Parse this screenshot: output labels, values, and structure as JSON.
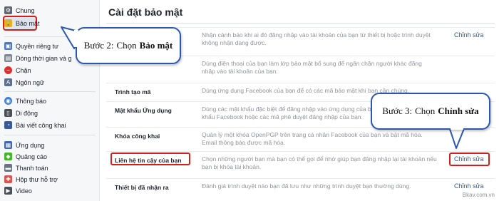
{
  "sidebar": {
    "items": [
      {
        "label": "Chung",
        "icon": "gear-icon"
      },
      {
        "label": "Bảo mật",
        "icon": "lock-icon"
      },
      {
        "label": "Quyền riêng tư",
        "icon": "privacy-icon"
      },
      {
        "label": "Dòng thời gian và g",
        "icon": "timeline-icon"
      },
      {
        "label": "Chặn",
        "icon": "block-icon"
      },
      {
        "label": "Ngôn ngữ",
        "icon": "language-icon"
      },
      {
        "label": "Thông báo",
        "icon": "globe-icon"
      },
      {
        "label": "Di động",
        "icon": "mobile-icon"
      },
      {
        "label": "Bài viết công khai",
        "icon": "rss-icon"
      },
      {
        "label": "Ứng dụng",
        "icon": "apps-icon"
      },
      {
        "label": "Quảng cáo",
        "icon": "ads-icon"
      },
      {
        "label": "Thanh toán",
        "icon": "payment-icon"
      },
      {
        "label": "Hộp thư hỗ trợ",
        "icon": "support-inbox-icon"
      },
      {
        "label": "Video",
        "icon": "video-icon"
      }
    ]
  },
  "main": {
    "title": "Cài đặt bảo mật",
    "edit_label": "Chỉnh sửa",
    "rows": [
      {
        "label": "",
        "desc": "Nhận cảnh báo khi ai đó đăng nhập vào tài khoản của bạn từ thiết bị hoặc trình duyệt không nhận dạng được.",
        "edit": "Chỉnh sửa"
      },
      {
        "label": "",
        "desc": "Dùng điện thoại của bạn làm lớp bảo mật bổ sung để ngăn chặn người khác đăng nhập vào tài khoản của bạn.",
        "edit": ""
      },
      {
        "label": "Trình tạo mã",
        "desc": "Dùng ứng dụng Facebook của bạn để có các mã bảo mật khi bạn cần chúng.",
        "edit": ""
      },
      {
        "label": "Mật khẩu Ứng dụng",
        "desc": "Dùng các mật khẩu đặc biệt để đăng nhập vào ứng dụng của bạn thay vì dùng mật khẩu Facebook hoặc các mã phê duyệt đăng nhập của bạn.",
        "edit": ""
      },
      {
        "label": "Khóa công khai",
        "desc": "Quản lý một khóa OpenPGP trên trang cá nhân Facebook của bạn và bật mã hóa. Email thông báo được mã hóa.",
        "edit": ""
      },
      {
        "label": "Liên hệ tin cậy của bạn",
        "desc": "Chọn những người bạn mà bạn có thể gọi để nhờ giúp bạn đăng nhập lại tài khoản nếu bạn bị khóa tài khoản.",
        "edit": "Chỉnh sửa"
      },
      {
        "label": "Thiết bị đã nhận ra",
        "desc": "Đánh giá trình duyệt nào bạn đã lưu như những trình duyệt bạn thường dùng.",
        "edit": "Chỉnh sửa"
      }
    ]
  },
  "callouts": {
    "step2": {
      "prefix": "Bước 2:",
      "text": "Chọn",
      "bold": "Bảo mật"
    },
    "step3": {
      "prefix": "Bước 3:",
      "text": "Chọn",
      "bold": "Chỉnh sửa"
    }
  },
  "watermark": "Bkav.com.vn",
  "colors": {
    "accent": "#365899",
    "highlight": "#d0201a",
    "callout_border": "#2a56b5"
  }
}
